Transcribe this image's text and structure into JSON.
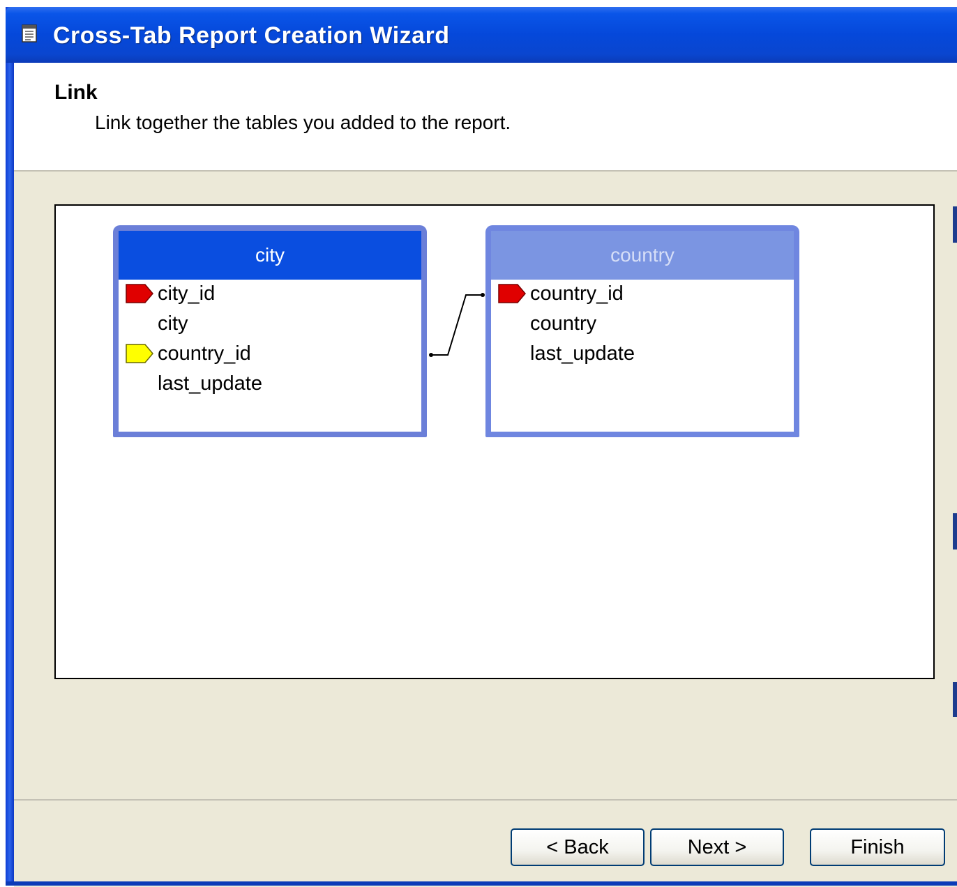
{
  "window": {
    "title": "Cross-Tab Report Creation Wizard",
    "icon": "report-document-icon"
  },
  "header": {
    "title": "Link",
    "subtitle": "Link together the tables you added to the report."
  },
  "tables": [
    {
      "name": "city",
      "state": "selected",
      "fields": [
        {
          "label": "city_id",
          "key": "primary"
        },
        {
          "label": "city",
          "key": "none"
        },
        {
          "label": "country_id",
          "key": "foreign"
        },
        {
          "label": "last_update",
          "key": "none"
        }
      ]
    },
    {
      "name": "country",
      "state": "unselected",
      "fields": [
        {
          "label": "country_id",
          "key": "primary"
        },
        {
          "label": "country",
          "key": "none"
        },
        {
          "label": "last_update",
          "key": "none"
        }
      ]
    }
  ],
  "links": [
    {
      "from": "city.country_id",
      "to": "country.country_id"
    }
  ],
  "buttons": {
    "back": "< Back",
    "next": "Next >",
    "finish": "Finish"
  },
  "colors": {
    "primary_key": "#e00000",
    "foreign_key": "#ffff00",
    "title_bar": "#0548da",
    "dialog_face": "#ece9d8"
  }
}
